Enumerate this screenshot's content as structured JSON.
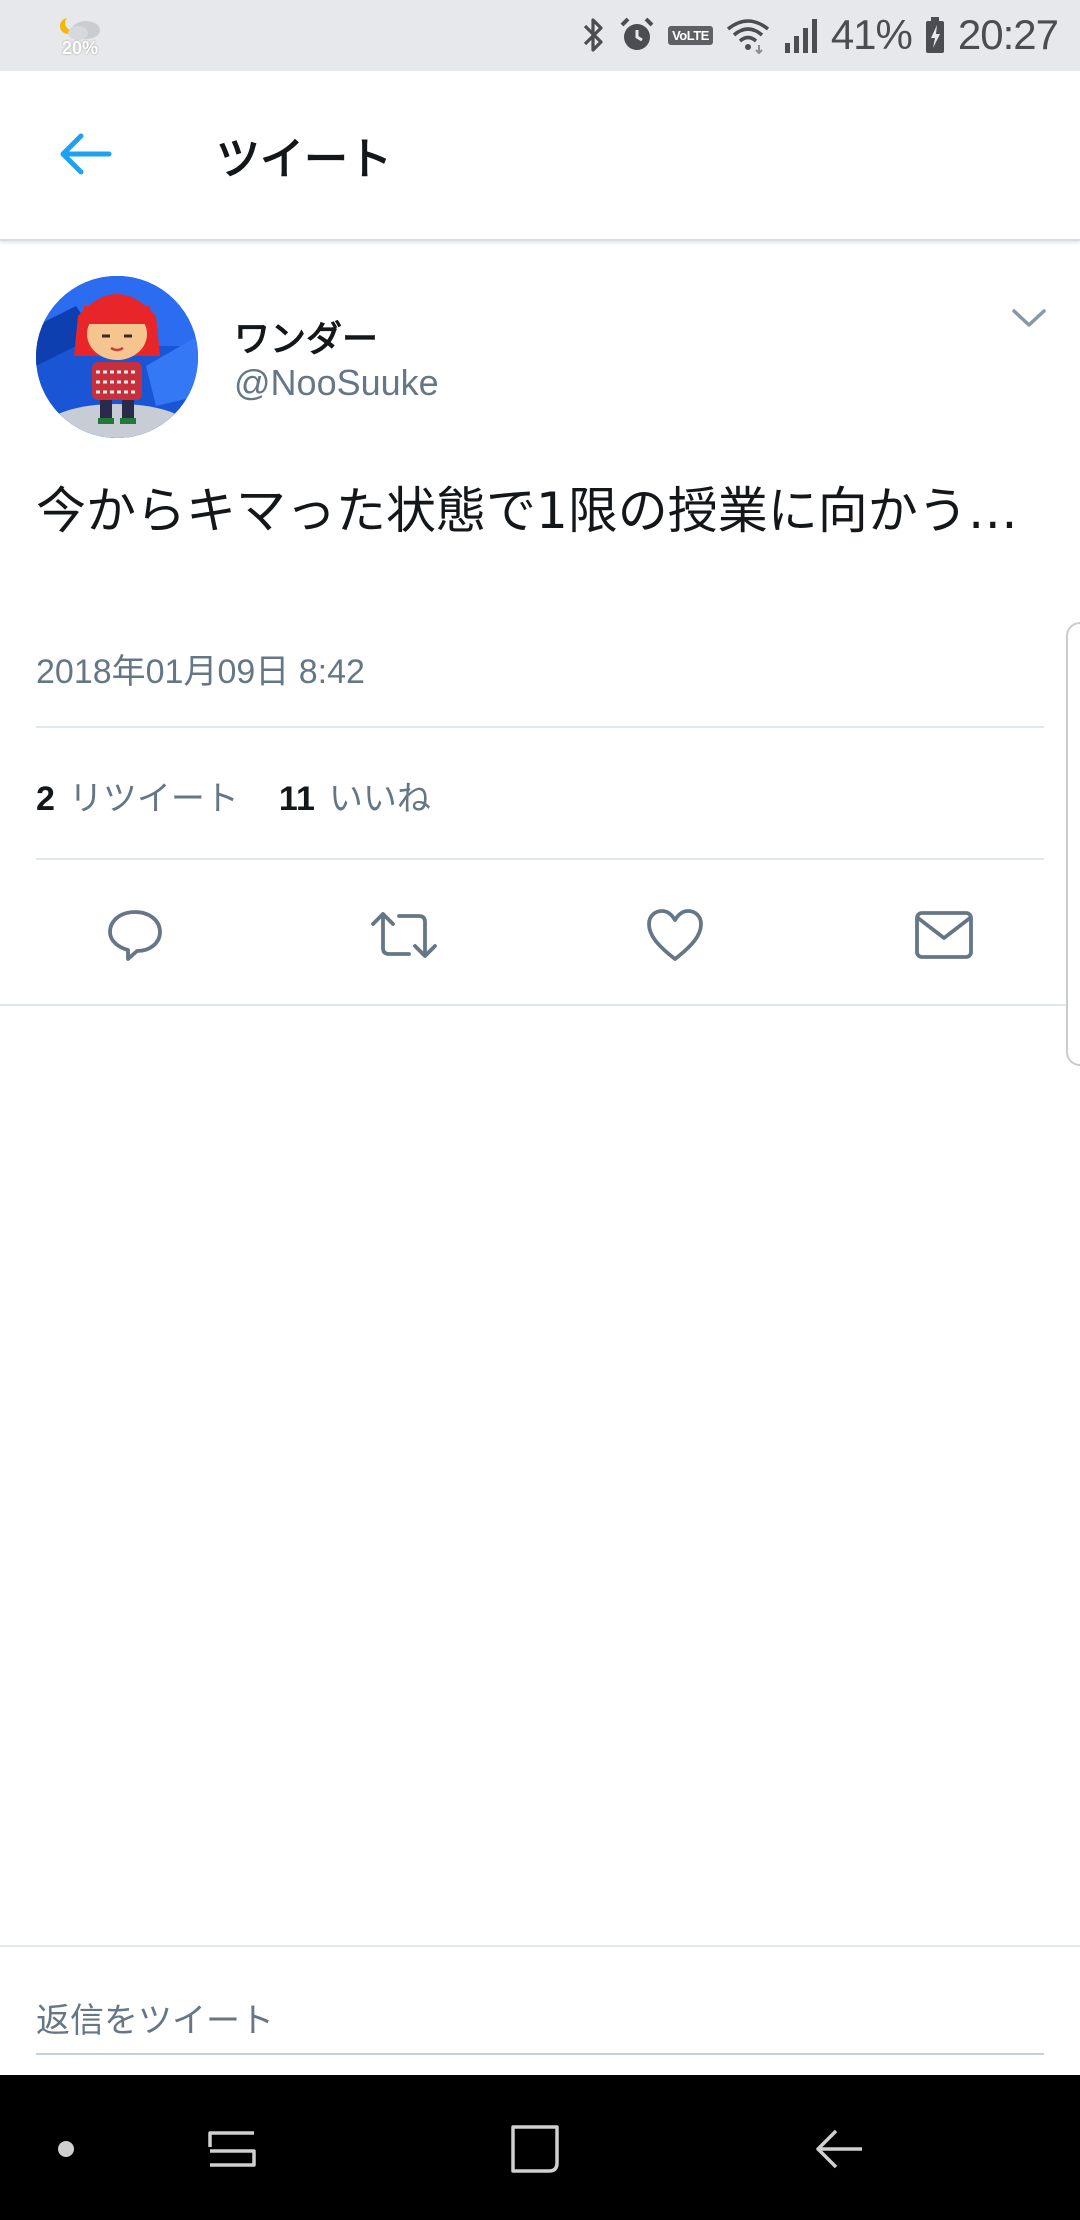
{
  "status_bar": {
    "weather_text": "20%",
    "volte_label": "VoLTE",
    "battery_percent": "41%",
    "time": "20:27",
    "icons": [
      "weather-icon",
      "bluetooth-icon",
      "alarm-icon",
      "volte-icon",
      "wifi-icon",
      "signal-icon",
      "battery-charging-icon"
    ]
  },
  "header": {
    "title": "ツイート",
    "back_icon": "arrow-left-icon"
  },
  "tweet": {
    "display_name": "ワンダー",
    "handle": "@NooSuuke",
    "text": "今からキマった状態で1限の授業に向かう…",
    "timestamp": "2018年01月09日 8:42",
    "retweet_count": "2",
    "retweet_label": "リツイート",
    "like_count": "11",
    "like_label": "いいね",
    "actions": [
      "reply-icon",
      "retweet-icon",
      "like-icon",
      "direct-message-icon"
    ]
  },
  "reply": {
    "placeholder": "返信をツイート"
  },
  "nav_bar": {
    "items": [
      "dot-icon",
      "recents-icon",
      "home-icon",
      "back-icon"
    ]
  },
  "colors": {
    "accent": "#1da1f2",
    "text_primary": "#14171a",
    "text_secondary": "#657786",
    "status_bar_bg": "#e6e8eb",
    "nav_bar_bg": "#000000"
  }
}
